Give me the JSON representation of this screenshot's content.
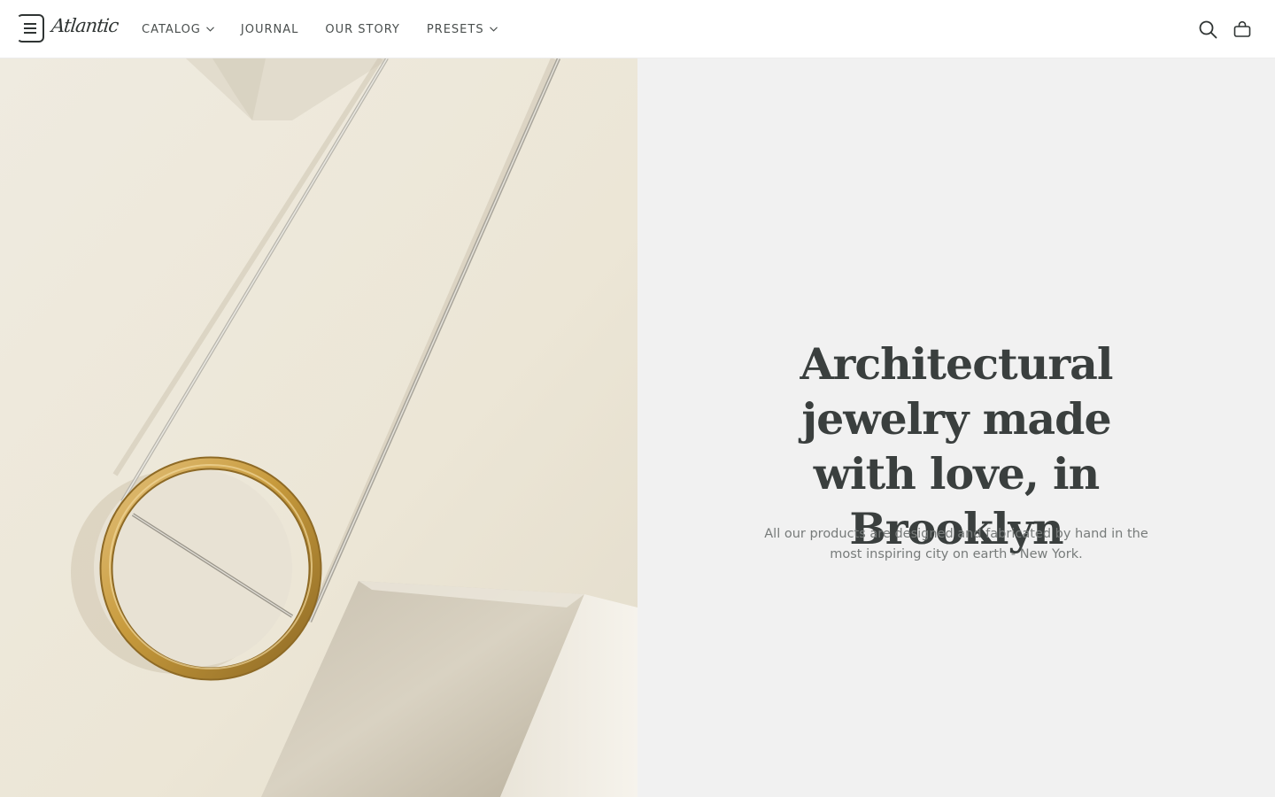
{
  "header": {
    "logo_text": "Atlantic",
    "nav": [
      {
        "label": "CATALOG",
        "has_dropdown": true
      },
      {
        "label": "JOURNAL",
        "has_dropdown": false
      },
      {
        "label": "OUR STORY",
        "has_dropdown": false
      },
      {
        "label": "PRESETS",
        "has_dropdown": true
      }
    ],
    "icons": [
      "menu-icon",
      "search-icon",
      "shopping-bag-icon"
    ]
  },
  "hero": {
    "headline": "Architectural jewelry made with love, in Brooklyn",
    "subtext": "All our products are designed and fabricated by hand in the most inspiring city on earth - New York."
  },
  "colors": {
    "text_dark": "#3a3f3e",
    "text_muted": "#777b7a",
    "panel_bg": "#f1f1f1",
    "photo_bg": "#ebe5d7",
    "gold": "#c79a3c"
  }
}
